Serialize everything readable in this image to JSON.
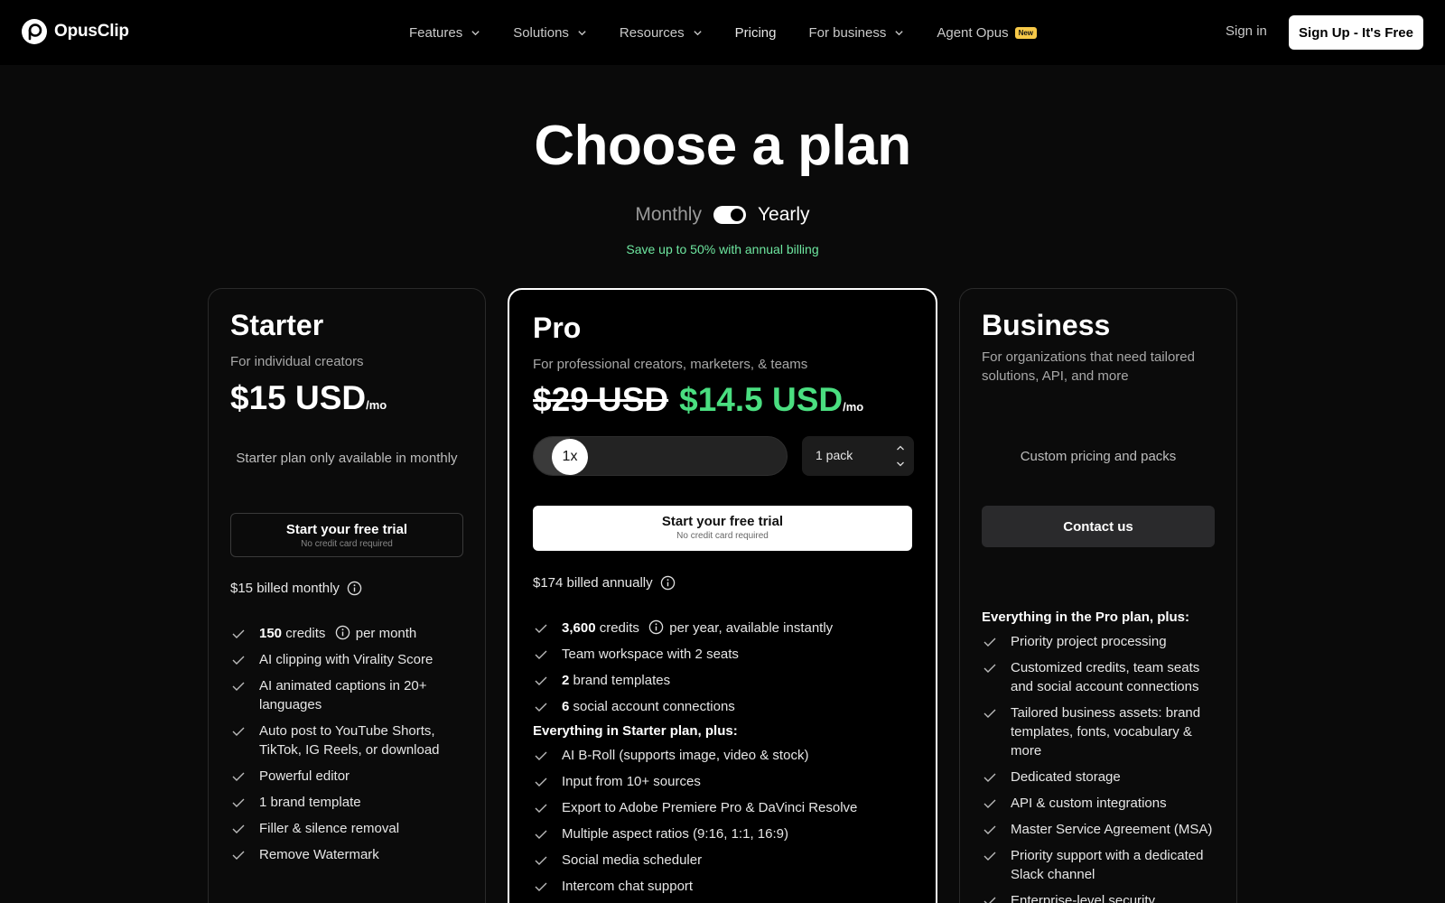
{
  "brand": {
    "name": "OpusClip"
  },
  "nav": {
    "items": [
      {
        "label": "Features",
        "dropdown": true
      },
      {
        "label": "Solutions",
        "dropdown": true
      },
      {
        "label": "Resources",
        "dropdown": true
      },
      {
        "label": "Pricing",
        "dropdown": false
      },
      {
        "label": "For business",
        "dropdown": true
      },
      {
        "label": "Agent Opus",
        "dropdown": false,
        "badge": "New"
      }
    ],
    "signin": "Sign in",
    "signup": "Sign Up - It's Free"
  },
  "hero": {
    "title": "Choose a plan",
    "billing_monthly": "Monthly",
    "billing_yearly": "Yearly",
    "billing_selected": "Yearly",
    "save_note": "Save up to 50% with annual billing"
  },
  "colors": {
    "accent_green": "#4ade80",
    "save_green": "#6ee7a0",
    "badge_yellow": "#f7c948"
  },
  "plans": {
    "starter": {
      "name": "Starter",
      "subtitle": "For individual creators",
      "price": "$15 USD",
      "per": "/mo",
      "note": "Starter plan only available in monthly",
      "cta": "Start your free trial",
      "cta_sub": "No credit card required",
      "billed": "$15 billed monthly",
      "features": [
        {
          "strong": "150",
          "text": " credits",
          "info": true,
          "after": " per month"
        },
        {
          "text": "AI clipping with Virality Score"
        },
        {
          "text": "AI animated captions in 20+ languages"
        },
        {
          "text": "Auto post to YouTube Shorts, TikTok, IG Reels, or download"
        },
        {
          "text": "Powerful editor"
        },
        {
          "text": "1 brand template"
        },
        {
          "text": "Filler & silence removal"
        },
        {
          "text": "Remove Watermark"
        }
      ]
    },
    "pro": {
      "name": "Pro",
      "subtitle": "For professional creators, marketers, & teams",
      "old_price": "$29 USD",
      "price": "$14.5 USD",
      "per": "/mo",
      "multiplier": "1x",
      "pack": "1 pack",
      "cta": "Start your free trial",
      "cta_sub": "No credit card required",
      "billed": "$174 billed annually",
      "features": [
        {
          "strong": "3,600",
          "text": " credits",
          "info": true,
          "after": " per year, available instantly"
        },
        {
          "text": "Team workspace with 2 seats"
        },
        {
          "strong": "2",
          "text": " brand templates"
        },
        {
          "strong": "6",
          "text": " social account connections"
        }
      ],
      "group_label": "Everything in Starter plan, plus:",
      "group_features": [
        "AI B-Roll (supports image, video & stock)",
        "Input from 10+ sources",
        "Export to Adobe Premiere Pro & DaVinci Resolve",
        "Multiple aspect ratios (9:16, 1:1, 16:9)",
        "Social media scheduler",
        "Intercom chat support"
      ]
    },
    "business": {
      "name": "Business",
      "subtitle": "For organizations that need tailored solutions, API, and more",
      "note": "Custom pricing and packs",
      "cta": "Contact us",
      "group_label": "Everything in the Pro plan, plus:",
      "features": [
        "Priority project processing",
        "Customized credits, team seats and social account connections",
        "Tailored business assets: brand templates, fonts, vocabulary & more",
        "Dedicated storage",
        "API & custom integrations",
        "Master Service Agreement (MSA)",
        "Priority support with a dedicated Slack channel",
        "Enterprise-level security"
      ]
    }
  }
}
